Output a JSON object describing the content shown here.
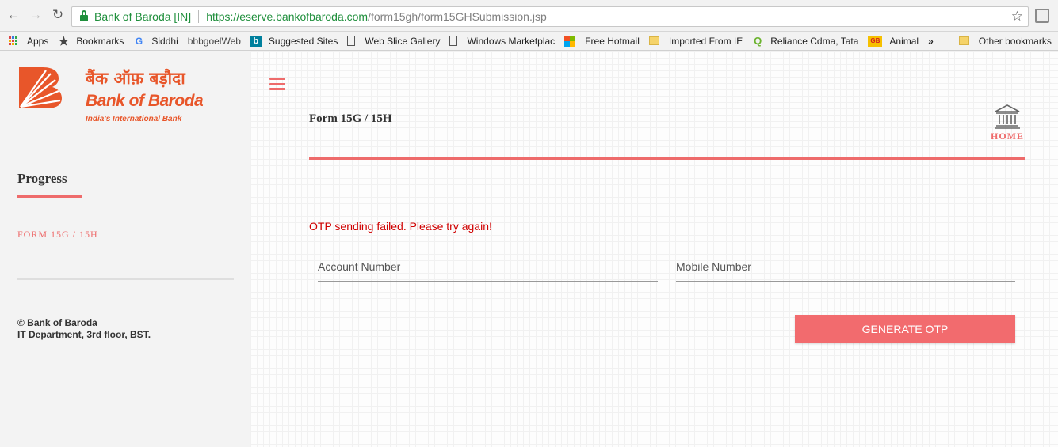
{
  "browser": {
    "secure_label": "Bank of Baroda [IN]",
    "url_host": "https://eserve.bankofbaroda.com",
    "url_path": "/form15gh/form15GHSubmission.jsp"
  },
  "bookmarks": {
    "apps": "Apps",
    "bookmarks": "Bookmarks",
    "siddhi": "Siddhi",
    "bbbgoel": "bbbgoelWeb",
    "suggested": "Suggested Sites",
    "web_slice": "Web Slice Gallery",
    "windows_market": "Windows Marketplac",
    "hotmail": "Free Hotmail",
    "imported": "Imported From IE",
    "reliance": "Reliance Cdma, Tata",
    "animal": "Animal",
    "more": "»",
    "other": "Other bookmarks"
  },
  "logo": {
    "hindi": "बैंक ऑफ़ बड़ौदा",
    "name": "Bank of Baroda",
    "tagline": "India's International Bank",
    "brand_color": "#e8562a"
  },
  "sidebar": {
    "progress_title": "Progress",
    "step": "FORM 15G / 15H",
    "footer_line1": "© Bank of Baroda",
    "footer_line2": "IT Department, 3rd floor, BST."
  },
  "main": {
    "form_title": "Form 15G / 15H",
    "home_label": "HOME",
    "error_message": "OTP sending failed. Please try again!",
    "account_placeholder": "Account Number",
    "mobile_placeholder": "Mobile Number",
    "generate_otp": "GENERATE OTP",
    "accent_color": "#ee6b6b",
    "error_color": "#d00000"
  }
}
